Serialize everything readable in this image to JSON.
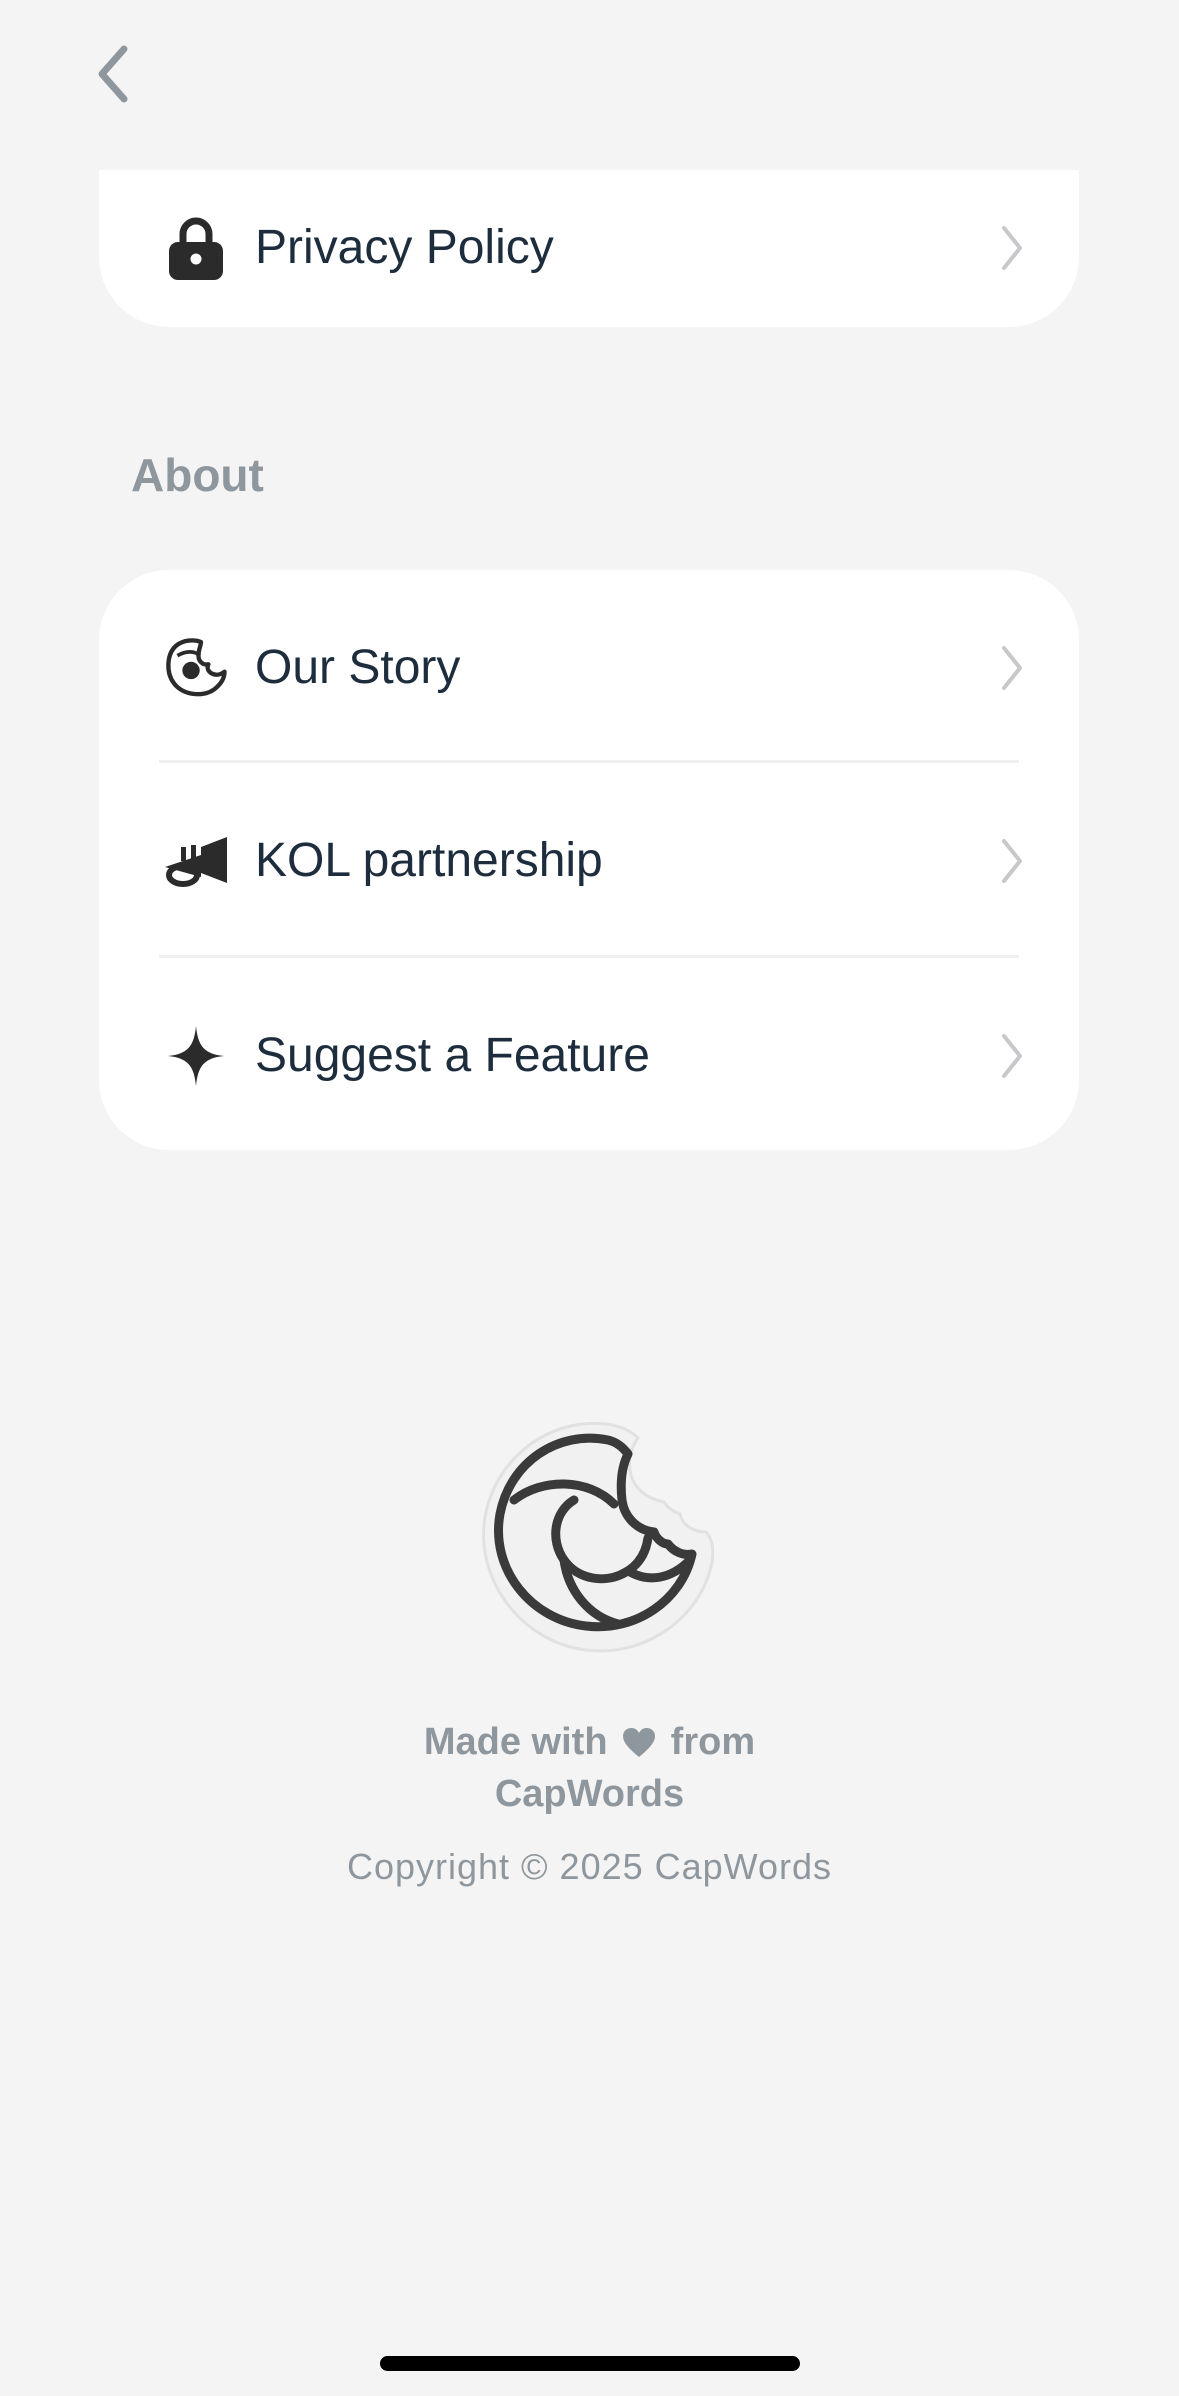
{
  "navigation": {
    "back_icon": "chevron-left-icon"
  },
  "settings_top": {
    "items": [
      {
        "label": "Privacy Policy",
        "icon": "lock-icon"
      }
    ]
  },
  "about": {
    "title": "About",
    "items": [
      {
        "label": "Our Story",
        "icon": "capwords-logo-icon"
      },
      {
        "label": "KOL partnership",
        "icon": "trumpet-icon"
      },
      {
        "label": "Suggest a Feature",
        "icon": "sparkle-icon"
      }
    ]
  },
  "footer": {
    "made_with_prefix": "Made with",
    "made_with_suffix": "from",
    "brand": "CapWords",
    "copyright": "Copyright © 2025 CapWords",
    "heart_icon": "heart-icon",
    "logo_icon": "capwords-logo-icon"
  },
  "colors": {
    "background": "#f4f4f4",
    "card": "#ffffff",
    "text": "#1e2d3d",
    "muted": "#8f979e",
    "chevron": "#c7c7cc"
  }
}
